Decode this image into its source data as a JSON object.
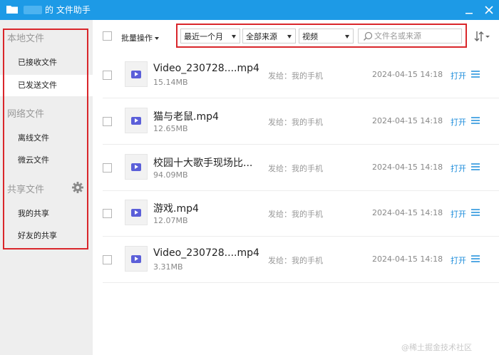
{
  "window": {
    "title": "的 文件助手"
  },
  "sidebar": {
    "local_section": "本地文件",
    "local_items": [
      {
        "label": "已接收文件"
      },
      {
        "label": "已发送文件"
      }
    ],
    "network_section": "网络文件",
    "network_items": [
      {
        "label": "离线文件"
      },
      {
        "label": "微云文件"
      }
    ],
    "shared_section": "共享文件",
    "shared_items": [
      {
        "label": "我的共享"
      },
      {
        "label": "好友的共享"
      }
    ]
  },
  "toolbar": {
    "bulk_label": "批量操作",
    "filters": [
      {
        "selected": "最近一个月"
      },
      {
        "selected": "全部来源"
      },
      {
        "selected": "视频"
      }
    ],
    "search_placeholder": "文件名或来源"
  },
  "files": [
    {
      "name": "Video_230728....mp4",
      "size": "15.14MB",
      "sent_to": "发给：我的手机",
      "date": "2024-04-15 14:18",
      "open": "打开"
    },
    {
      "name": "猫与老鼠.mp4",
      "size": "12.65MB",
      "sent_to": "发给：我的手机",
      "date": "2024-04-15 14:18",
      "open": "打开"
    },
    {
      "name": "校园十大歌手现场比...",
      "size": "94.09MB",
      "sent_to": "发给：我的手机",
      "date": "2024-04-15 14:18",
      "open": "打开"
    },
    {
      "name": "游戏.mp4",
      "size": "12.07MB",
      "sent_to": "发给：我的手机",
      "date": "2024-04-15 14:18",
      "open": "打开"
    },
    {
      "name": "Video_230728....mp4",
      "size": "3.31MB",
      "sent_to": "发给：我的手机",
      "date": "2024-04-15 14:18",
      "open": "打开"
    }
  ],
  "watermark": "@稀土掘金技术社区",
  "colors": {
    "titlebar": "#1d9ae6",
    "accent": "#1d8ddb",
    "highlight_box": "#d9262b",
    "play_icon": "#5b5fd9"
  }
}
